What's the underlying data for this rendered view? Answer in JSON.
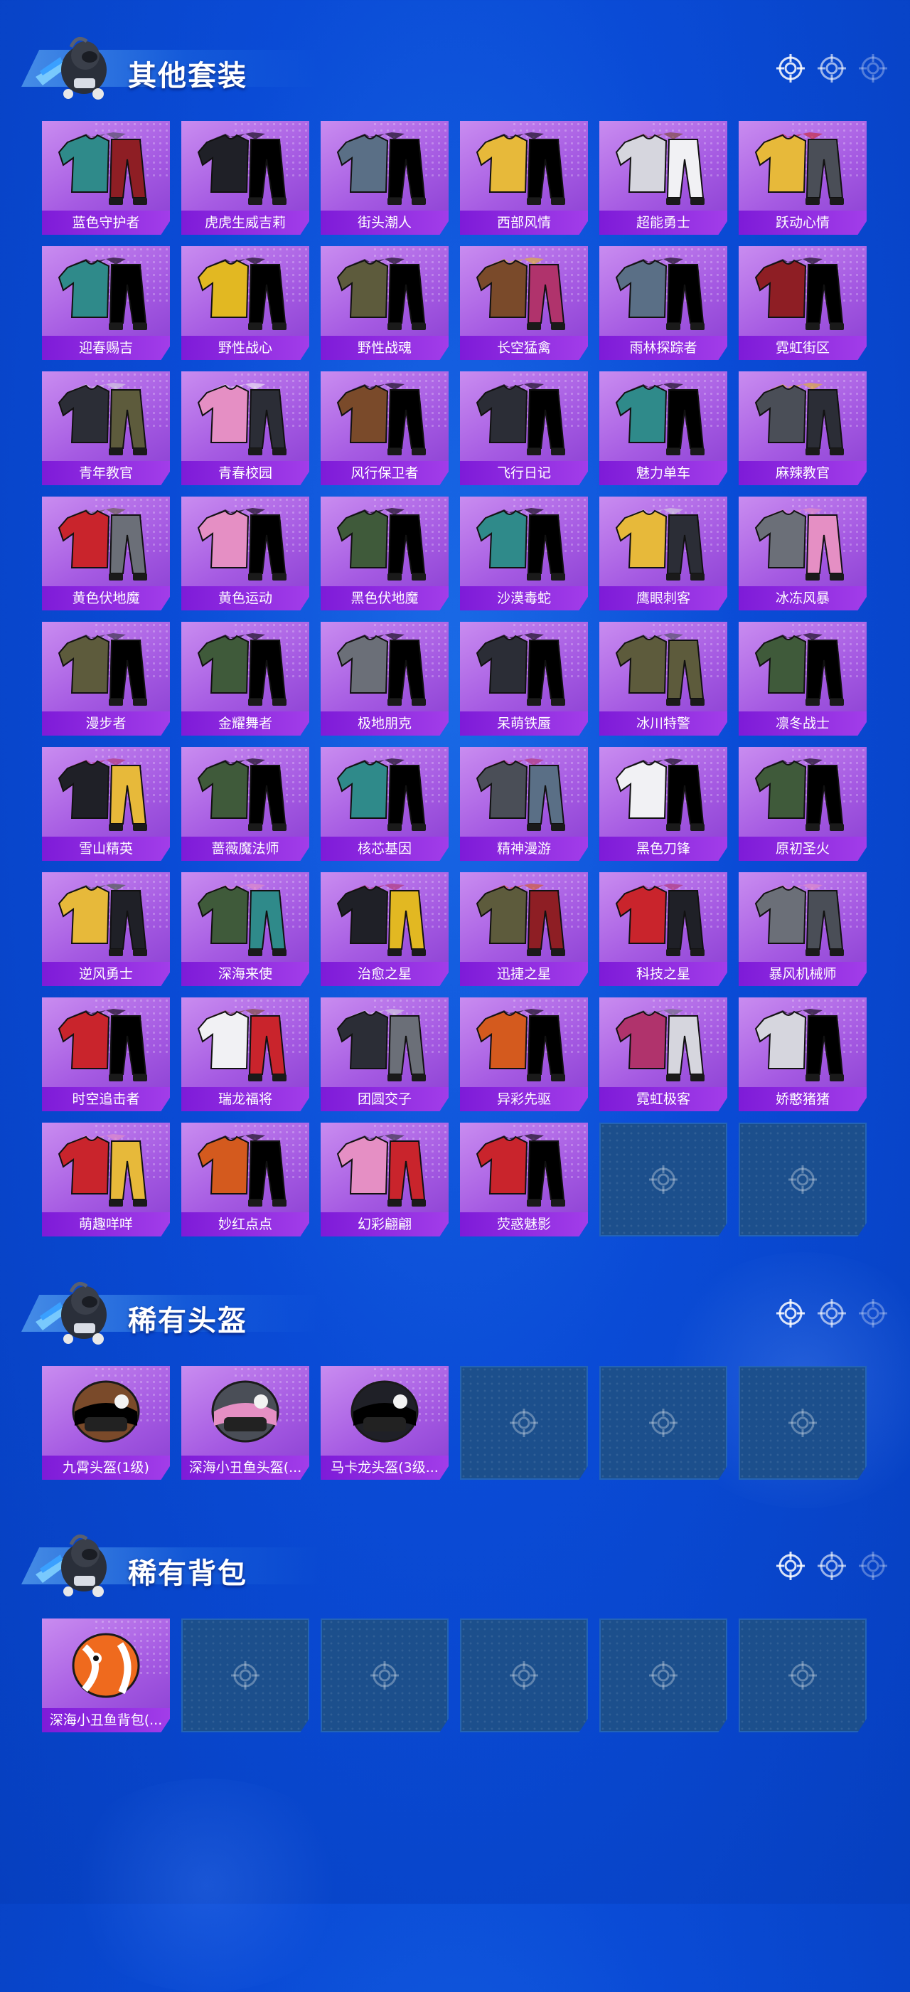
{
  "sections": [
    {
      "title": "其他套装",
      "items": [
        {
          "label": "蓝色守护者",
          "art": "dark-jacket"
        },
        {
          "label": "虎虎生威吉莉",
          "art": "red-suit"
        },
        {
          "label": "街头潮人",
          "art": "red-puffer"
        },
        {
          "label": "西部风情",
          "art": "cowboy"
        },
        {
          "label": "超能勇士",
          "art": "olive-vest"
        },
        {
          "label": "跃动心情",
          "art": "yellow-hoodie"
        },
        {
          "label": "迎春赐吉",
          "art": "orange-jacket"
        },
        {
          "label": "野性战心",
          "art": "tank-top"
        },
        {
          "label": "野性战魂",
          "art": "tank-top-grey"
        },
        {
          "label": "长空猛禽",
          "art": "camo-jacket"
        },
        {
          "label": "雨林探踪者",
          "art": "green-jacket"
        },
        {
          "label": "霓虹街区",
          "art": "pink-outfit"
        },
        {
          "label": "青年教官",
          "art": "white-uniform"
        },
        {
          "label": "青春校园",
          "art": "school-uniform"
        },
        {
          "label": "风行保卫者",
          "art": "black-coat"
        },
        {
          "label": "飞行日记",
          "art": "pilot-outfit"
        },
        {
          "label": "魅力单车",
          "art": "yellow-tee"
        },
        {
          "label": "麻辣教官",
          "art": "white-coat"
        },
        {
          "label": "黄色伏地魔",
          "art": "yellow-ghillie"
        },
        {
          "label": "黄色运动",
          "art": "yellow-sport"
        },
        {
          "label": "黑色伏地魔",
          "art": "black-ghillie"
        },
        {
          "label": "沙漠毒蛇",
          "art": "desert-outfit"
        },
        {
          "label": "鹰眼刺客",
          "art": "hawk-assassin"
        },
        {
          "label": "冰冻风暴",
          "art": "ice-storm"
        },
        {
          "label": "漫步者",
          "art": "walker"
        },
        {
          "label": "金耀舞者",
          "art": "gold-dancer"
        },
        {
          "label": "极地朋克",
          "art": "polar-punk"
        },
        {
          "label": "呆萌铁蜃",
          "art": "cute-costume"
        },
        {
          "label": "冰川特警",
          "art": "white-police"
        },
        {
          "label": "凛冬战士",
          "art": "winter-soldier"
        },
        {
          "label": "雪山精英",
          "art": "green-parka"
        },
        {
          "label": "蔷薇魔法师",
          "art": "rose-mage"
        },
        {
          "label": "核芯基因",
          "art": "core-gene"
        },
        {
          "label": "精神漫游",
          "art": "spirit-roam"
        },
        {
          "label": "黑色刀锋",
          "art": "black-blade"
        },
        {
          "label": "原初圣火",
          "art": "primal-fire"
        },
        {
          "label": "逆风勇士",
          "art": "armor"
        },
        {
          "label": "深海来使",
          "art": "deep-sea"
        },
        {
          "label": "治愈之星",
          "art": "healing-star"
        },
        {
          "label": "迅捷之星",
          "art": "swift-star"
        },
        {
          "label": "科技之星",
          "art": "tech-star"
        },
        {
          "label": "暴风机械师",
          "art": "storm-mech"
        },
        {
          "label": "时空追击者",
          "art": "red-mech"
        },
        {
          "label": "瑞龙福将",
          "art": "dragon-general"
        },
        {
          "label": "团圆交子",
          "art": "reunion"
        },
        {
          "label": "异彩先驱",
          "art": "colorful"
        },
        {
          "label": "霓虹极客",
          "art": "neon-geek"
        },
        {
          "label": "娇憨猪猪",
          "art": "pig-outfit"
        },
        {
          "label": "萌趣咩咩",
          "art": "sheep-outfit"
        },
        {
          "label": "妙红点点",
          "art": "red-dots"
        },
        {
          "label": "幻彩翩翩",
          "art": "fairy-dress"
        },
        {
          "label": "荧惑魅影",
          "art": "phantom"
        },
        null,
        null
      ]
    },
    {
      "title": "稀有头盔",
      "items": [
        {
          "label": "九霄头盔(1级)",
          "art": "helmet-1"
        },
        {
          "label": "深海小丑鱼头盔(...",
          "art": "helmet-clownfish"
        },
        {
          "label": "马卡龙头盔(3级...",
          "art": "helmet-macaron"
        },
        null,
        null,
        null
      ]
    },
    {
      "title": "稀有背包",
      "items": [
        {
          "label": "深海小丑鱼背包(...",
          "art": "backpack-clownfish"
        },
        null,
        null,
        null,
        null,
        null
      ]
    }
  ],
  "colors": {
    "background": "#0a4bd6",
    "tile_filled": "#a55ae2",
    "tile_label": "#7e1bd8",
    "tile_empty": "#1c4f8c"
  }
}
